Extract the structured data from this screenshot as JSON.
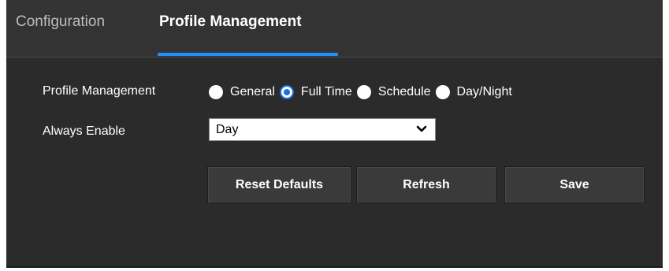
{
  "tabs": {
    "configuration": "Configuration",
    "profile_management": "Profile Management"
  },
  "form": {
    "profile_management_label": "Profile Management",
    "profile_options": [
      {
        "label": "General",
        "checked": false
      },
      {
        "label": "Full Time",
        "checked": true
      },
      {
        "label": "Schedule",
        "checked": false
      },
      {
        "label": "Day/Night",
        "checked": false
      }
    ],
    "always_enable_label": "Always Enable",
    "always_enable_value": "Day"
  },
  "buttons": {
    "reset": "Reset Defaults",
    "refresh": "Refresh",
    "save": "Save"
  },
  "colors": {
    "accent": "#1e90ff",
    "radio_checked": "#1e6fe8",
    "background": "#2b2b2b"
  },
  "icons": {
    "select_chevron": "chevron-down-icon"
  }
}
